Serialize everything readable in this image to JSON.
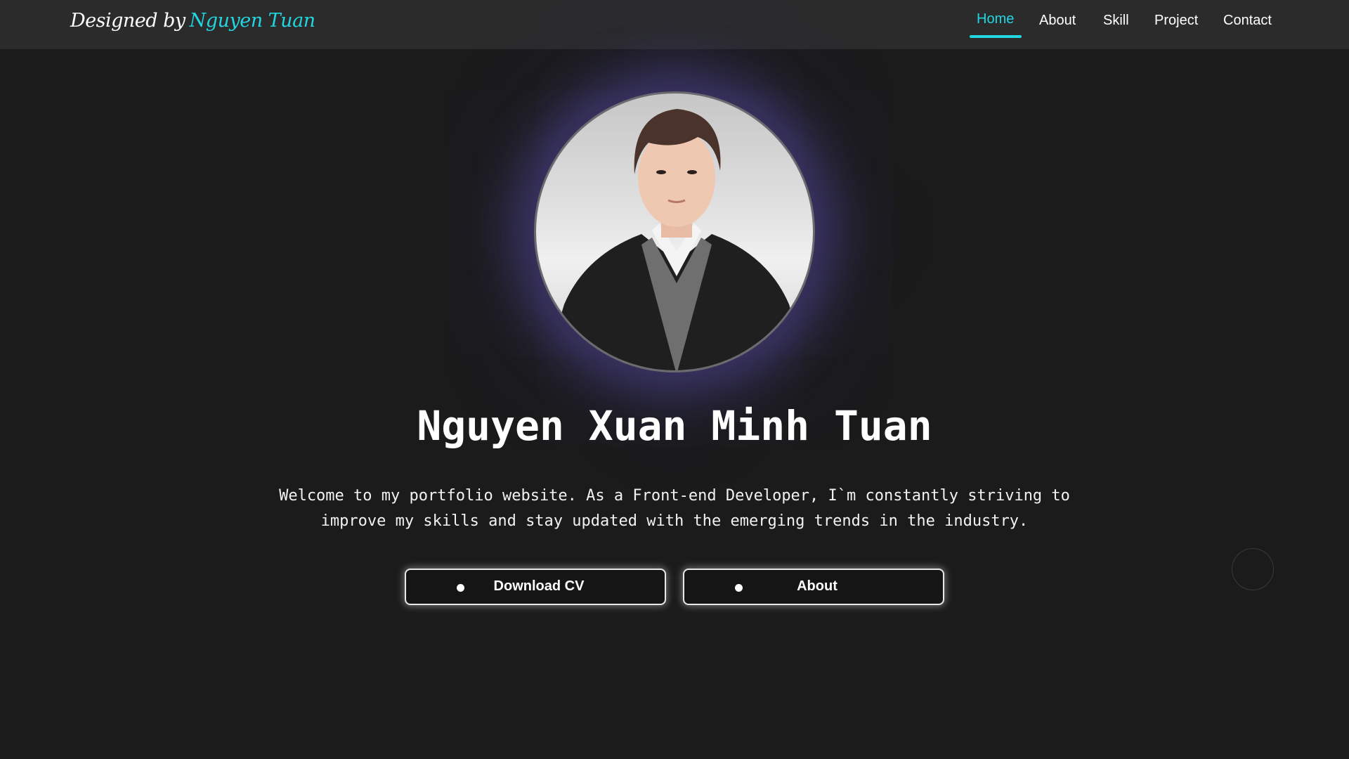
{
  "brand": {
    "prefix": "Designed by",
    "name": "Nguyen Tuan"
  },
  "nav": {
    "items": [
      {
        "label": "Home",
        "active": true
      },
      {
        "label": "About",
        "active": false
      },
      {
        "label": "Skill",
        "active": false
      },
      {
        "label": "Project",
        "active": false
      },
      {
        "label": "Contact",
        "active": false
      }
    ]
  },
  "hero": {
    "name": "Nguyen Xuan Minh Tuan",
    "description_line1": "Welcome to my portfolio website. As a Front-end Developer, I`m constantly striving to",
    "description_line2": "improve my skills and stay updated with the emerging trends in the industry.",
    "buttons": [
      {
        "label": "Download CV"
      },
      {
        "label": "About"
      }
    ]
  },
  "colors": {
    "accent": "#22d6e0",
    "background": "#1b1b1c",
    "navbar": "#2b2b2c"
  }
}
